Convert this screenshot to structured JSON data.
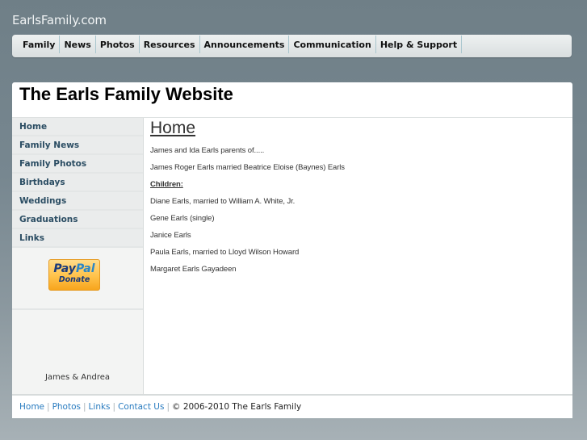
{
  "site": {
    "name": "EarlsFamily.com"
  },
  "topnav": {
    "items": [
      {
        "label": "Family"
      },
      {
        "label": "News"
      },
      {
        "label": "Photos"
      },
      {
        "label": "Resources"
      },
      {
        "label": "Announcements"
      },
      {
        "label": "Communication"
      },
      {
        "label": "Help & Support"
      }
    ]
  },
  "header": {
    "title": "The Earls Family Website"
  },
  "sidebar": {
    "items": [
      {
        "label": "Home"
      },
      {
        "label": "Family News"
      },
      {
        "label": "Family Photos"
      },
      {
        "label": "Birthdays"
      },
      {
        "label": "Weddings"
      },
      {
        "label": "Graduations"
      },
      {
        "label": "Links"
      }
    ],
    "paypal": {
      "logo_part1": "Pay",
      "logo_part2": "Pal",
      "label": "Donate"
    },
    "credit": "James & Andrea"
  },
  "content": {
    "heading": "Home",
    "paragraphs": [
      "James and Ida Earls parents of.....",
      "James Roger Earls married Beatrice Eloise (Baynes) Earls"
    ],
    "children_label": "Children:",
    "children": [
      "Diane Earls, married to William A. White, Jr.",
      "Gene Earls (single)",
      "Janice Earls",
      "Paula Earls, married to Lloyd Wilson Howard",
      "Margaret Earls Gayadeen"
    ]
  },
  "footer": {
    "links": [
      {
        "label": "Home"
      },
      {
        "label": "Photos"
      },
      {
        "label": "Links"
      },
      {
        "label": "Contact Us"
      }
    ],
    "separator": "|",
    "copyright": "© 2006-2010 The Earls Family"
  },
  "colors": {
    "background": "#6f7f87",
    "sidebar_link": "#2b4d63",
    "footer_link": "#2a7cc0",
    "paypal_orange": "#ffc24a"
  }
}
